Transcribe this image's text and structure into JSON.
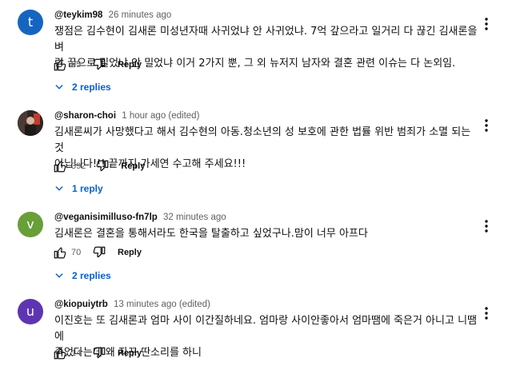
{
  "comments": [
    {
      "avatar_letter": "t",
      "avatar_color": "#1565c0",
      "author": "@teykim98",
      "time": "26 minutes ago",
      "lines": [
        "쟁점은 김수현이 김새론 미성년자때 사귀었냐 안 사귀었냐. 7억 갚으라고 일거리 다 끊긴 김새론을 벼",
        "랑 끝으로 밀었냐 안 밀었냐 이거 2가지 뿐, 그 외 뉴저지 남자와 결혼 관련 이슈는 다 논외임."
      ],
      "likes": "95",
      "reply_label": "Reply",
      "replies_label": "2 replies"
    },
    {
      "avatar_letter": "",
      "avatar_color": "#3a2f2c",
      "author": "@sharon-choi",
      "time": "1 hour ago (edited)",
      "lines": [
        "김새론씨가 사망했다고 해서 김수현의 아동.청소년의 성 보호에 관한 법률 위반 범죄가 소멸 되는 것",
        "아닙니다!!! 끝까지 가세연 수고해 주세요!!!"
      ],
      "likes": "392",
      "reply_label": "Reply",
      "replies_label": "1 reply"
    },
    {
      "avatar_letter": "v",
      "avatar_color": "#689f38",
      "author": "@veganisimilluso-fn7lp",
      "time": "32 minutes ago",
      "lines": [
        "김새론은 결혼을 통해서라도 한국을 탈출하고 싶었구나.맘이 너무 아프다"
      ],
      "likes": "70",
      "reply_label": "Reply",
      "replies_label": "2 replies"
    },
    {
      "avatar_letter": "u",
      "avatar_color": "#5e35b1",
      "author": "@kiopuiytrb",
      "time": "13 minutes ago (edited)",
      "lines": [
        "이진호는 또 김새론과 엄마 사이 이간질하네요. 엄마랑 사이안좋아서 엄마땜에 죽은거 아니고 니땜에",
        "죽었다는데 왜 자꾸 딴소리를 하니"
      ],
      "likes": "14",
      "reply_label": "Reply",
      "replies_label": ""
    }
  ]
}
